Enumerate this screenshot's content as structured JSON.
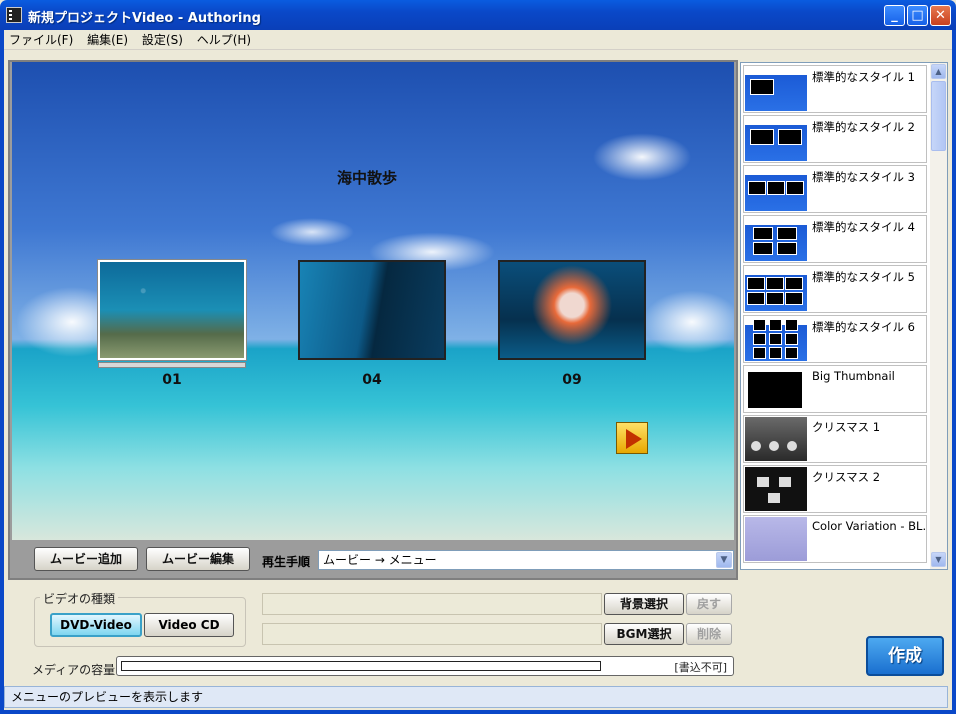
{
  "window": {
    "title": "新規プロジェクトVideo - Authoring",
    "minimize": "_",
    "maximize": "□",
    "close": "✕"
  },
  "menu": [
    {
      "label": "ファイル(F)"
    },
    {
      "label": "編集(E)"
    },
    {
      "label": "設定(S)"
    },
    {
      "label": "ヘルプ(H)"
    }
  ],
  "preview": {
    "menu_title": "海中散歩",
    "thumbnails": [
      {
        "label": "01",
        "selected": true
      },
      {
        "label": "04",
        "selected": false
      },
      {
        "label": "09",
        "selected": false
      }
    ]
  },
  "toolbar": {
    "add_movie": "ムービー追加",
    "edit_movie": "ムービー編集",
    "play_order_label": "再生手順",
    "play_order_value": "ムービー → メニュー"
  },
  "styles": [
    {
      "name": "標準的なスタイル 1",
      "layout": "1"
    },
    {
      "name": "標準的なスタイル 2",
      "layout": "2"
    },
    {
      "name": "標準的なスタイル 3",
      "layout": "3"
    },
    {
      "name": "標準的なスタイル 4",
      "layout": "4"
    },
    {
      "name": "標準的なスタイル 5",
      "layout": "6"
    },
    {
      "name": "標準的なスタイル 6",
      "layout": "9"
    },
    {
      "name": "Big Thumbnail",
      "layout": "big"
    },
    {
      "name": "クリスマス 1",
      "layout": "xmas1"
    },
    {
      "name": "クリスマス 2",
      "layout": "xmas2"
    },
    {
      "name": "Color Variation - BL...",
      "layout": "color"
    }
  ],
  "video_type": {
    "label": "ビデオの種類",
    "options": [
      "DVD-Video",
      "Video CD"
    ],
    "selected": "DVD-Video"
  },
  "background": {
    "select_label": "背景選択",
    "back_label": "戻す"
  },
  "bgm": {
    "select_label": "BGM選択",
    "delete_label": "削除"
  },
  "capacity": {
    "label": "メディアの容量",
    "status": "[書込不可]",
    "fraction": 0.79
  },
  "create_label": "作成",
  "status_text": "メニューのプレビューを表示します"
}
